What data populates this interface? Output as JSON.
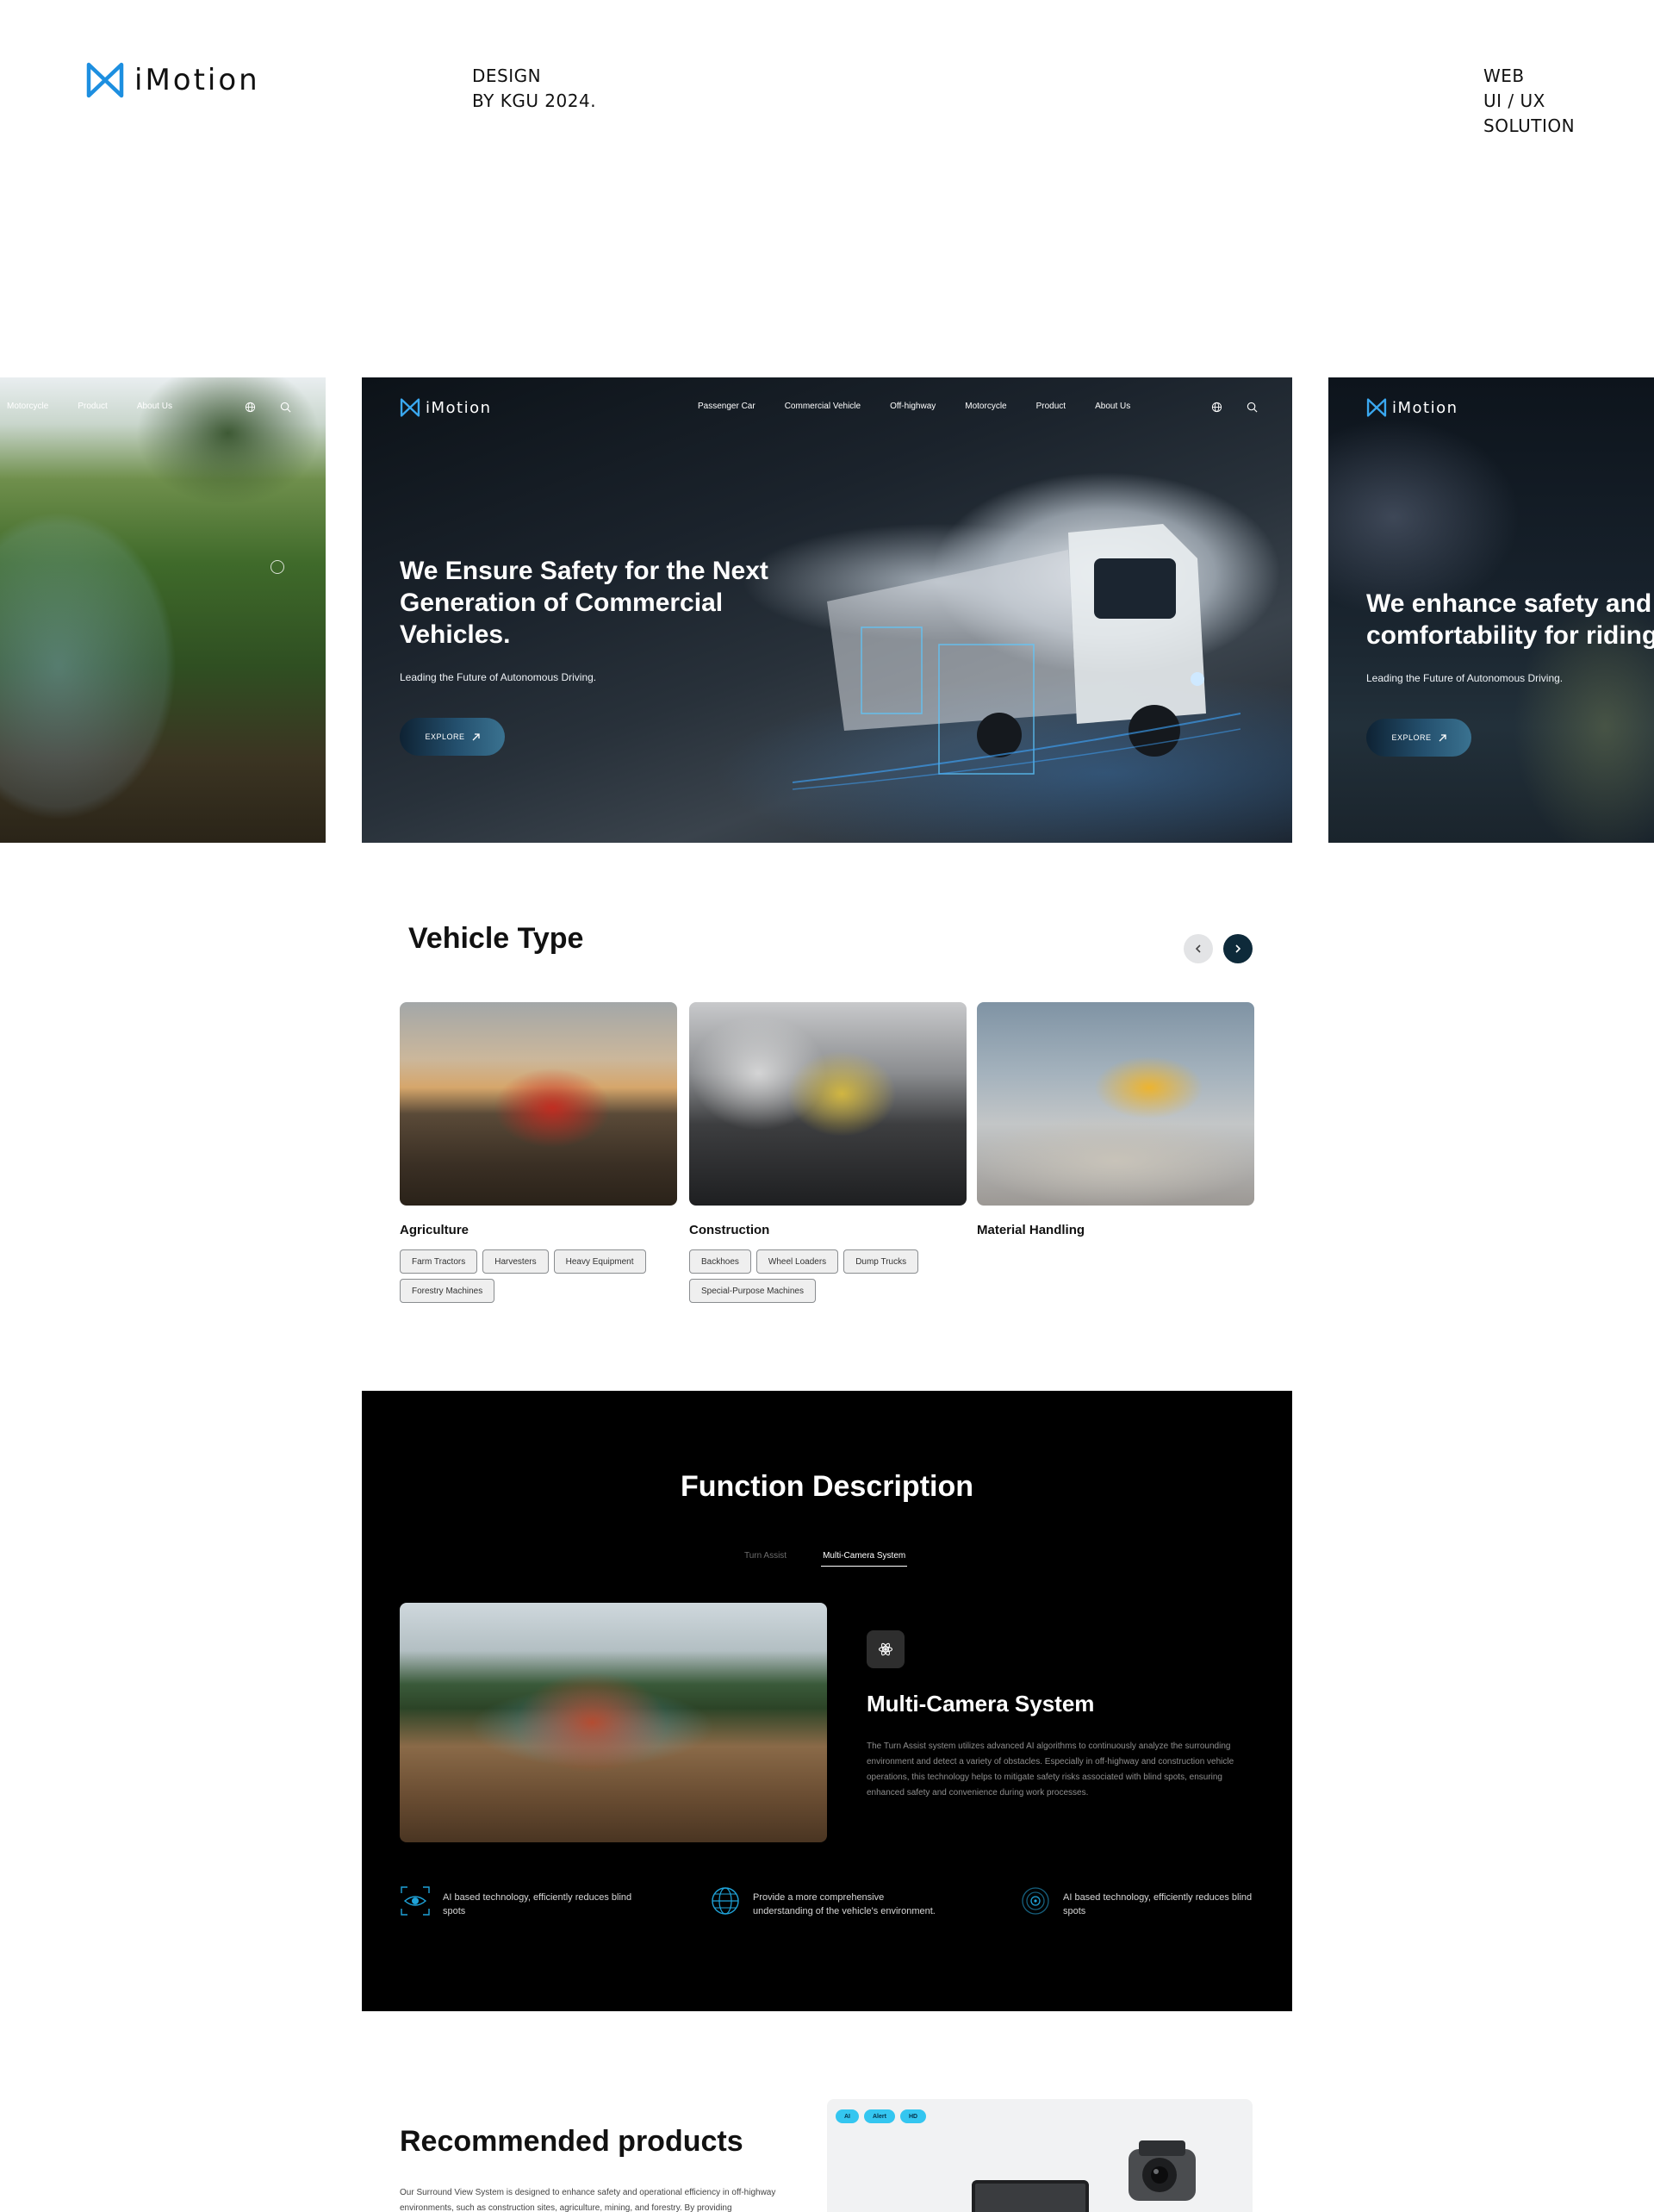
{
  "brand": {
    "name": "iMotion"
  },
  "meta": {
    "design_lines": [
      "DESIGN",
      "BY KGU 2024."
    ],
    "project_lines": [
      "WEB",
      "UI / UX",
      "SOLUTION"
    ]
  },
  "hero": {
    "left_slide": {
      "nav": [
        "Motorcycle",
        "Product",
        "About Us"
      ]
    },
    "main_slide": {
      "nav": [
        "Passenger Car",
        "Commercial Vehicle",
        "Off-highway",
        "Motorcycle",
        "Product",
        "About Us"
      ],
      "title": "We Ensure Safety for the Next Generation of Commercial Vehicles.",
      "subtitle": "Leading the Future of Autonomous Driving.",
      "cta": "EXPLORE"
    },
    "right_slide": {
      "title": "We enhance safety and comfortability for riding",
      "subtitle": "Leading the Future of Autonomous Driving.",
      "cta": "EXPLORE"
    }
  },
  "vehicle_type": {
    "title": "Vehicle Type",
    "cards": [
      {
        "label": "Agriculture",
        "chips": [
          "Farm Tractors",
          "Harvesters",
          "Heavy Equipment",
          "Forestry Machines"
        ]
      },
      {
        "label": "Construction",
        "chips": [
          "Backhoes",
          "Wheel Loaders",
          "Dump Trucks",
          "Special-Purpose Machines"
        ]
      },
      {
        "label": "Material Handling",
        "chips": []
      }
    ]
  },
  "function": {
    "title": "Function Description",
    "tabs": [
      "Turn Assist",
      "Multi-Camera System"
    ],
    "active_tab": "Multi-Camera System",
    "heading": "Multi-Camera System",
    "body": "The Turn Assist system utilizes advanced AI algorithms to continuously analyze the surrounding environment and detect a variety of obstacles. Especially in off-highway and construction vehicle operations, this technology helps to mitigate safety risks associated with blind spots, ensuring enhanced safety and convenience during work processes.",
    "features": [
      {
        "icon": "eye-scan-icon",
        "text": "AI based technology, efficiently reduces blind spots"
      },
      {
        "icon": "globe-icon",
        "text": "Provide a more comprehensive understanding of the vehicle's environment."
      },
      {
        "icon": "radar-icon",
        "text": "AI based technology, efficiently reduces blind spots"
      }
    ],
    "accent_color": "#1fa3d9"
  },
  "recommended": {
    "title": "Recommended products",
    "text": "Our Surround View System is designed to enhance safety and operational efficiency in off-highway environments, such as construction sites, agriculture, mining, and forestry. By providing",
    "tags": [
      "AI",
      "Alert",
      "HD"
    ]
  }
}
